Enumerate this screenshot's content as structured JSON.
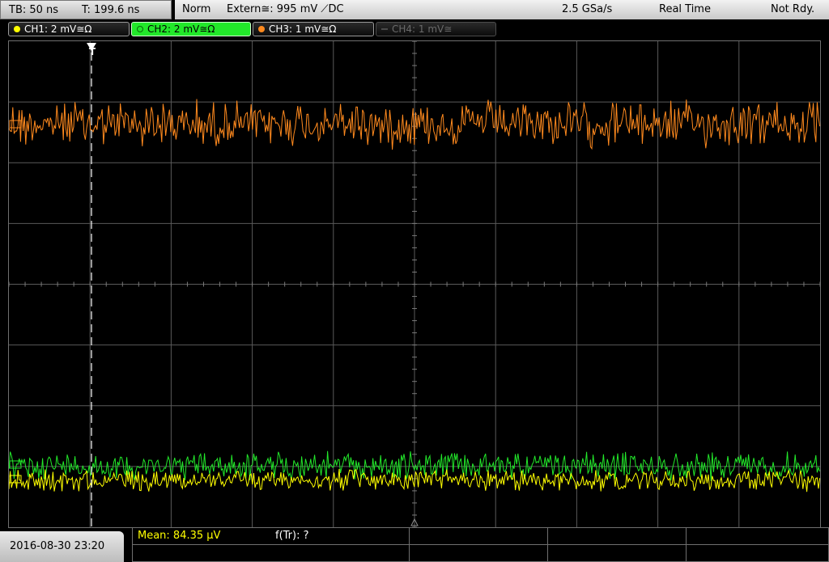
{
  "status": {
    "timebase": "TB: 50 ns",
    "trigger_time": "T: 199.6 ns",
    "mode": "Norm",
    "trigger_source": "Extern≅: 995 mV ⟋DC",
    "sample_rate": "2.5 GSa/s",
    "acquisition": "Real Time",
    "state": "Not Rdy."
  },
  "channels": [
    {
      "label": "CH1: 2 mV≅Ω",
      "color": "#ffff00",
      "state": "on"
    },
    {
      "label": "CH2: 2 mV≅Ω",
      "color": "#22e82a",
      "state": "selected"
    },
    {
      "label": "CH3: 1 mV≅Ω",
      "color": "#ff8a1e",
      "state": "on"
    },
    {
      "label": "CH4: 1 mV≅",
      "color": "#6a6a6a",
      "state": "off"
    }
  ],
  "screen": {
    "trigger_marker": "T",
    "grid_color": "#5a5a5a",
    "trace_colors": {
      "ch1": "#ffff00",
      "ch2": "#22e82a",
      "ch3": "#ff8a1e"
    }
  },
  "footer": {
    "datetime": "2016-08-30 23:20",
    "measurement": "Mean: 84.35 µV",
    "measurement2": "f(Tr): ?"
  }
}
